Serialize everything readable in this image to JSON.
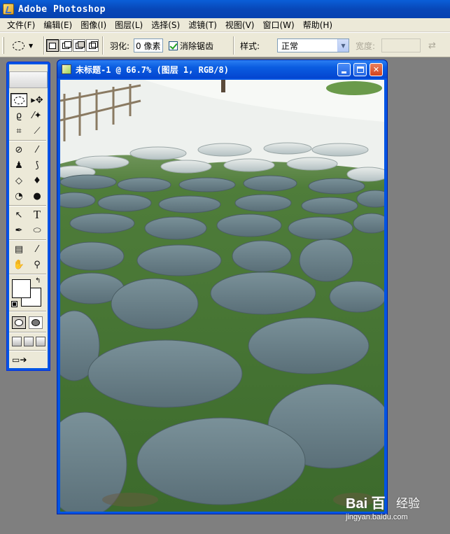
{
  "app": {
    "title": "Adobe Photoshop"
  },
  "menu": {
    "items": [
      "文件(F)",
      "编辑(E)",
      "图像(I)",
      "图层(L)",
      "选择(S)",
      "滤镜(T)",
      "视图(V)",
      "窗口(W)",
      "帮助(H)"
    ]
  },
  "options": {
    "tool_icon": "elliptical-marquee-icon",
    "feather_label": "羽化:",
    "feather_value": "0 像素",
    "antialias_label": "消除锯齿",
    "antialias_checked": true,
    "style_label": "样式:",
    "style_value": "正常",
    "width_label": "宽度:",
    "width_value": ""
  },
  "tools": [
    "elliptical-marquee-icon",
    "move-icon",
    "lasso-icon",
    "magic-wand-icon",
    "crop-icon",
    "slice-icon",
    "healing-brush-icon",
    "brush-icon",
    "clone-stamp-icon",
    "history-brush-icon",
    "eraser-icon",
    "paint-bucket-icon",
    "blur-icon",
    "dodge-icon",
    "path-selection-icon",
    "type-icon",
    "pen-icon",
    "ellipse-shape-icon",
    "notes-icon",
    "eyedropper-icon",
    "hand-icon",
    "zoom-icon"
  ],
  "colors": {
    "foreground": "#ffffff",
    "background": "#ffffff",
    "titlebar": "#0a5fd8",
    "chrome": "#ece9d8",
    "workspace": "#7f7f7f"
  },
  "document": {
    "title": "未标题-1 @ 66.7% (图层 1, RGB/8)",
    "image_description": "stone path with grass between stones"
  },
  "watermark": {
    "logo": "Bai 百",
    "text": "经验",
    "url": "jingyan.baidu.com"
  }
}
